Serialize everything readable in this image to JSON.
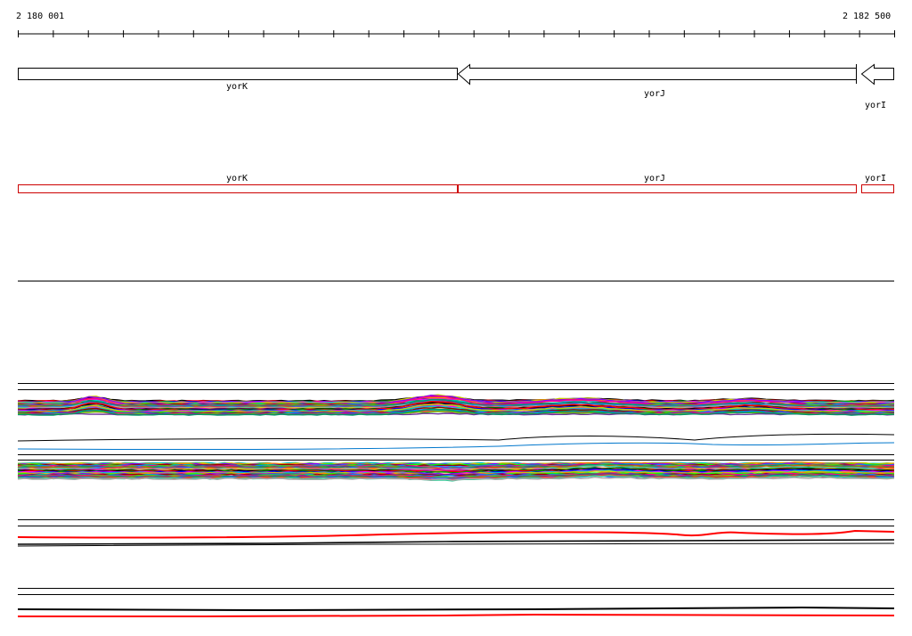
{
  "ruler": {
    "start_label": "2 180 001",
    "end_label": "2 182 500",
    "start": 2180001,
    "end": 2182500
  },
  "genes": [
    {
      "name": "yorK",
      "strand": "-",
      "start": 2180001,
      "end": 2181255
    },
    {
      "name": "yorJ",
      "strand": "-",
      "start": 2181255,
      "end": 2182392
    },
    {
      "name": "yorI",
      "strand": "-",
      "start": 2182407,
      "end": 2182500
    }
  ],
  "gene_labels": {
    "arrow_yorK": "yorK",
    "arrow_yorJ": "yorJ",
    "arrow_yorI": "yorI",
    "box_yorK": "yorK",
    "box_yorJ": "yorJ",
    "box_yorI": "yorI"
  },
  "colors": {
    "annotation_box": "#cc0000",
    "track_primary": "#000000",
    "track_highlight": "#ff0000"
  },
  "expression_tracks": {
    "group_1": {
      "series_count": 40
    },
    "group_2": {
      "series_count": 2
    },
    "group_3": {
      "series_count": 40
    },
    "group_4": {
      "series_count": 4
    },
    "group_5": {
      "series_count": 2
    }
  }
}
